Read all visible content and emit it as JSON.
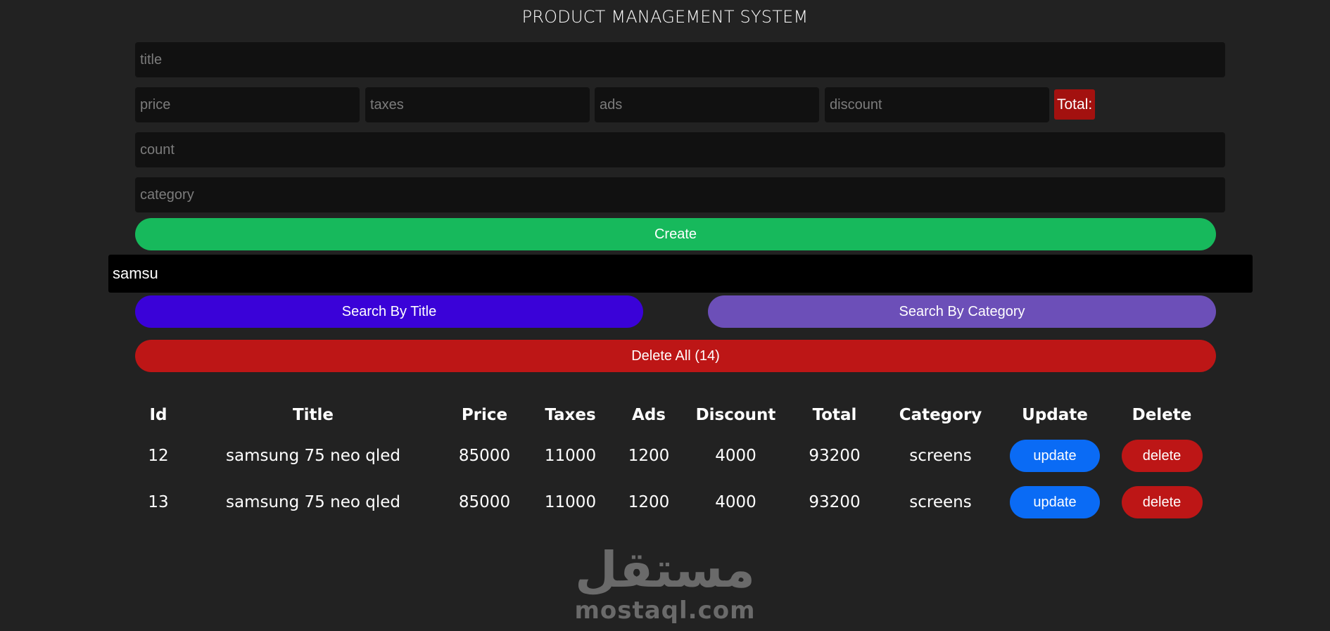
{
  "header": {
    "title": "PRODUCT MANAGEMENT SYSTEM"
  },
  "form": {
    "title_placeholder": "title",
    "price_placeholder": "price",
    "taxes_placeholder": "taxes",
    "ads_placeholder": "ads",
    "discount_placeholder": "discount",
    "total_label": "Total:",
    "count_placeholder": "count",
    "category_placeholder": "category",
    "create_label": "Create"
  },
  "search": {
    "value": "samsu",
    "by_title_label": "Search By Title",
    "by_category_label": "Search By Category"
  },
  "delete_all_label": "Delete All (14)",
  "table": {
    "headers": [
      "Id",
      "Title",
      "Price",
      "Taxes",
      "Ads",
      "Discount",
      "Total",
      "Category",
      "Update",
      "Delete"
    ],
    "rows": [
      {
        "id": "12",
        "title": "samsung 75 neo qled",
        "price": "85000",
        "taxes": "11000",
        "ads": "1200",
        "discount": "4000",
        "total": "93200",
        "category": "screens",
        "update": "update",
        "delete": "delete"
      },
      {
        "id": "13",
        "title": "samsung 75 neo qled",
        "price": "85000",
        "taxes": "11000",
        "ads": "1200",
        "discount": "4000",
        "total": "93200",
        "category": "screens",
        "update": "update",
        "delete": "delete"
      }
    ]
  },
  "watermark": {
    "arabic": "مستقل",
    "latin": "mostaql.com"
  },
  "colors": {
    "background": "#222222",
    "input": "#111111",
    "create": "#17b95c",
    "search_title": "#3a02d8",
    "search_category": "#6c4fb8",
    "danger": "#bd1616",
    "total_badge": "#a3110f",
    "update": "#0a6bf5"
  }
}
